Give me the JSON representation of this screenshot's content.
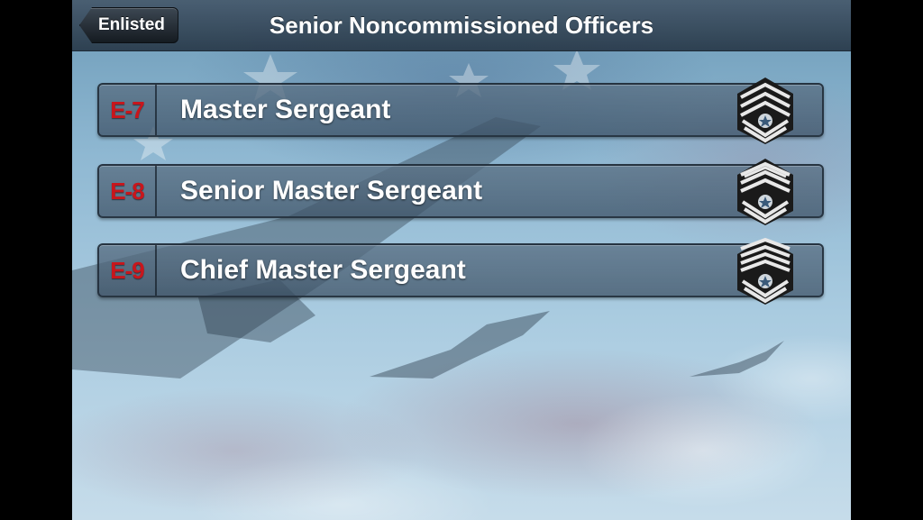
{
  "navbar": {
    "back_label": "Enlisted",
    "title": "Senior Noncommissioned Officers"
  },
  "ranks": [
    {
      "grade": "E-7",
      "title": "Master Sergeant",
      "icon": "master-sergeant-chevron-icon"
    },
    {
      "grade": "E-8",
      "title": "Senior Master Sergeant",
      "icon": "senior-master-sergeant-chevron-icon"
    },
    {
      "grade": "E-9",
      "title": "Chief Master Sergeant",
      "icon": "chief-master-sergeant-chevron-icon"
    }
  ],
  "colors": {
    "grade_red": "#c8161c",
    "title_white": "#ffffff"
  }
}
